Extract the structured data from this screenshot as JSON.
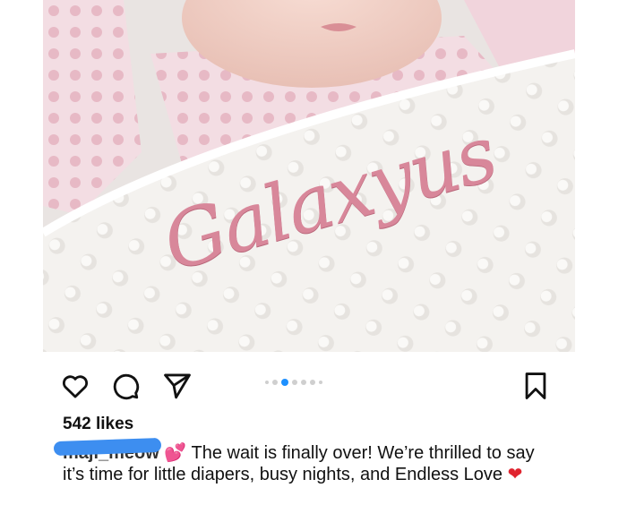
{
  "post": {
    "image_text": "Galaxyus",
    "likes": "542 likes",
    "username": "maji_meow",
    "emoji_after_username": "💕",
    "caption": "The wait is finally over! We’re thrilled to say it’s time for little diapers, busy nights, and Endless Love",
    "emoji_end": "❤",
    "carousel": {
      "count": 7,
      "active_index": 2
    }
  },
  "icons": {
    "like": "heart-outline-icon",
    "comment": "comment-bubble-icon",
    "share": "paper-plane-icon",
    "save": "bookmark-icon"
  },
  "colors": {
    "carousel_active": "#1e90ff",
    "embroidery": "#d8879a",
    "redaction": "#3d8ef0"
  }
}
